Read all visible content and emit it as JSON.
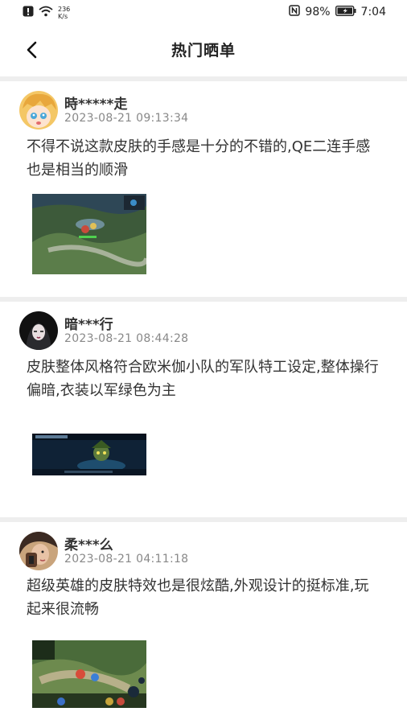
{
  "status_bar": {
    "net_speed": "236",
    "net_unit": "K/s",
    "battery": "98%",
    "time": "7:04"
  },
  "header": {
    "title": "热门晒单",
    "back_icon": "chevron-left-icon"
  },
  "posts": [
    {
      "username": "時*****走",
      "timestamp": "2023-08-21 09:13:34",
      "text": "不得不说这款皮肤的手感是十分的不错的,QE二连手感也是相当的顺滑"
    },
    {
      "username": "暗***行",
      "timestamp": "2023-08-21 08:44:28",
      "text": " 皮肤整体风格符合欧米伽小队的军队特工设定,整体操行偏暗,衣装以军绿色为主"
    },
    {
      "username": "柔***么",
      "timestamp": "2023-08-21 04:11:18",
      "text": "超级英雄的皮肤特效也是很炫酷,外观设计的挺标准,玩起来很流畅"
    }
  ]
}
